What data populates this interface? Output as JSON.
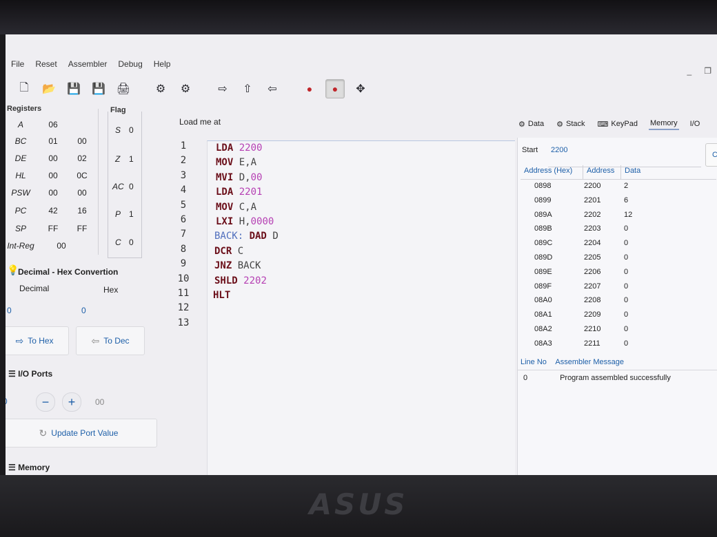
{
  "menu": [
    "File",
    "Reset",
    "Assembler",
    "Debug",
    "Help"
  ],
  "window": {
    "minimize_glyph": "_",
    "restore_glyph": "❐"
  },
  "toolbar": [
    {
      "icon": "new-file-icon",
      "glyph": "🗋"
    },
    {
      "icon": "open-folder-icon",
      "glyph": "📂"
    },
    {
      "icon": "save-icon",
      "glyph": "💾"
    },
    {
      "icon": "save-as-icon",
      "glyph": "💾"
    },
    {
      "icon": "print-icon",
      "glyph": "🖨"
    },
    {
      "icon": "assemble-icon",
      "glyph": "⚙"
    },
    {
      "icon": "run-icon",
      "glyph": "⚙"
    },
    {
      "icon": "step-forward-icon",
      "glyph": "⇨"
    },
    {
      "icon": "step-over-icon",
      "glyph": "⇧"
    },
    {
      "icon": "step-back-icon",
      "glyph": "⇦"
    },
    {
      "icon": "breakpoint-icon",
      "glyph": "●"
    },
    {
      "icon": "record-icon",
      "glyph": "●"
    },
    {
      "icon": "fullscreen-icon",
      "glyph": "✥"
    }
  ],
  "registers": {
    "title": "Registers",
    "rows": [
      {
        "name": "A",
        "v1": "06",
        "v2": ""
      },
      {
        "name": "BC",
        "v1": "01",
        "v2": "00"
      },
      {
        "name": "DE",
        "v1": "00",
        "v2": "02"
      },
      {
        "name": "HL",
        "v1": "00",
        "v2": "0C"
      },
      {
        "name": "PSW",
        "v1": "00",
        "v2": "00"
      },
      {
        "name": "PC",
        "v1": "42",
        "v2": "16"
      },
      {
        "name": "SP",
        "v1": "FF",
        "v2": "FF"
      },
      {
        "name": "Int-Reg",
        "v1": "00",
        "v2": ""
      }
    ]
  },
  "flags": {
    "title": "Flag",
    "rows": [
      {
        "name": "S",
        "value": "0"
      },
      {
        "name": "Z",
        "value": "1"
      },
      {
        "name": "AC",
        "value": "0"
      },
      {
        "name": "P",
        "value": "1"
      },
      {
        "name": "C",
        "value": "0"
      }
    ]
  },
  "conversion": {
    "title": "Decimal - Hex Convertion",
    "decimal_label": "Decimal",
    "hex_label": "Hex",
    "decimal_value": "0",
    "hex_value": "0",
    "to_hex": "To Hex",
    "to_dec": "To Dec"
  },
  "io": {
    "title": "I/O Ports",
    "port": "0",
    "value": "00",
    "minus": "−",
    "plus": "+",
    "update": "Update Port Value"
  },
  "memory_footer": "Memory",
  "editor": {
    "load_label": "Load me at",
    "line_numbers": [
      "1",
      "2",
      "3",
      "4",
      "5",
      "6",
      "7",
      "8",
      "9",
      "10",
      "11",
      "12",
      "13"
    ],
    "lines": [
      {
        "label": "",
        "kw": "LDA",
        "sep": " ",
        "ops": "",
        "num": "2200"
      },
      {
        "label": "",
        "kw": "MOV",
        "sep": " ",
        "ops": "E,A",
        "num": ""
      },
      {
        "label": "",
        "kw": "MVI",
        "sep": " ",
        "ops": "D,",
        "num": "00"
      },
      {
        "label": "",
        "kw": "LDA",
        "sep": " ",
        "ops": "",
        "num": "2201"
      },
      {
        "label": "",
        "kw": "MOV",
        "sep": " ",
        "ops": "C,A",
        "num": ""
      },
      {
        "label": "",
        "kw": "LXI",
        "sep": " ",
        "ops": "H,",
        "num": "0000"
      },
      {
        "label": "BACK: ",
        "kw": "DAD",
        "sep": " ",
        "ops": "D",
        "num": ""
      },
      {
        "label": "",
        "kw": "DCR",
        "sep": " ",
        "ops": "C",
        "num": ""
      },
      {
        "label": "",
        "kw": "JNZ",
        "sep": " ",
        "ops": "BACK",
        "num": ""
      },
      {
        "label": "",
        "kw": "SHLD",
        "sep": " ",
        "ops": "",
        "num": "2202"
      },
      {
        "label": "",
        "kw": "HLT",
        "sep": "",
        "ops": "",
        "num": ""
      }
    ]
  },
  "tabs": [
    {
      "icon": "data-icon",
      "label": "Data"
    },
    {
      "icon": "stack-icon",
      "label": "Stack"
    },
    {
      "icon": "keypad-icon",
      "label": "KeyPad"
    },
    {
      "icon": "",
      "label": "Memory"
    },
    {
      "icon": "",
      "label": "I/O"
    }
  ],
  "memory": {
    "start_label": "Start",
    "start_value": "2200",
    "columns": [
      "Address (Hex)",
      "Address",
      "Data"
    ],
    "rows": [
      [
        "0898",
        "2200",
        "2"
      ],
      [
        "0899",
        "2201",
        "6"
      ],
      [
        "089A",
        "2202",
        "12"
      ],
      [
        "089B",
        "2203",
        "0"
      ],
      [
        "089C",
        "2204",
        "0"
      ],
      [
        "089D",
        "2205",
        "0"
      ],
      [
        "089E",
        "2206",
        "0"
      ],
      [
        "089F",
        "2207",
        "0"
      ],
      [
        "08A0",
        "2208",
        "0"
      ],
      [
        "08A1",
        "2209",
        "0"
      ],
      [
        "08A2",
        "2210",
        "0"
      ],
      [
        "08A3",
        "2211",
        "0"
      ]
    ]
  },
  "messages": {
    "columns": [
      "Line No",
      "Assembler Message"
    ],
    "rows": [
      [
        "0",
        "Program assembled successfully"
      ]
    ]
  },
  "logo_text": "ASUS"
}
